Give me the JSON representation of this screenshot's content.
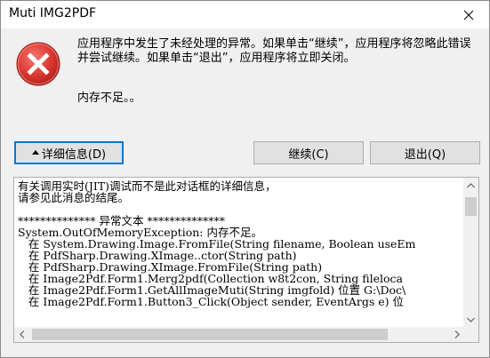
{
  "window": {
    "title": "Muti IMG2PDF"
  },
  "dialog": {
    "message": "应用程序中发生了未经处理的异常。如果单击“继续”，应用程序将忽略此错误并尝试继续。如果单击“退出”，应用程序将立即关闭。",
    "submessage": "内存不足。。"
  },
  "buttons": {
    "details": "详细信息(D)",
    "continue": "继续(C)",
    "quit": "退出(Q)"
  },
  "details": {
    "lines": [
      "有关调用实时(JIT)调试而不是此对话框的详细信息，",
      "请参见此消息的结尾。",
      "",
      "************** 异常文本 **************",
      "System.OutOfMemoryException: 内存不足。",
      "   在 System.Drawing.Image.FromFile(String filename, Boolean useEm",
      "   在 PdfSharp.Drawing.XImage..ctor(String path)",
      "   在 PdfSharp.Drawing.XImage.FromFile(String path)",
      "   在 Image2Pdf.Form1.Merg2pdf(Collection w8t2con, String fileloca",
      "   在 Image2Pdf.Form1.GetAllImageMuti(String imgfold) 位置 G:\\Doc\\",
      "   在 Image2Pdf.Form1.Button3_Click(Object sender, EventArgs e) 位"
    ]
  },
  "icons": {
    "error": "error-icon",
    "close": "close-icon"
  },
  "colors": {
    "error_red": "#d3302f",
    "focus_blue": "#0078d7"
  }
}
